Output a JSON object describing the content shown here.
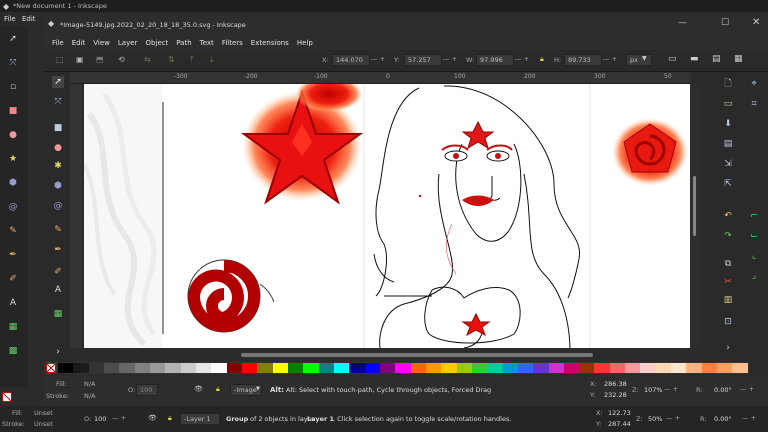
{
  "outer_window": {
    "title": "*New document 1 - Inkscape",
    "menu": [
      "File",
      "Edit"
    ]
  },
  "inner_window": {
    "title": "*Image-5149.jpg.2022_02_20_18_18_35.0.svg - Inkscape",
    "menu": [
      "File",
      "Edit",
      "View",
      "Layer",
      "Object",
      "Path",
      "Text",
      "Filters",
      "Extensions",
      "Help"
    ]
  },
  "tool_controls": {
    "x_label": "X:",
    "x_value": "144.070",
    "y_label": "Y:",
    "y_value": "57.257",
    "w_label": "W:",
    "w_value": "97.996",
    "h_label": "H:",
    "h_value": "89.733",
    "unit": "px"
  },
  "ruler_ticks": [
    "-300",
    "-200",
    "-100",
    "0",
    "100",
    "200",
    "300",
    "400",
    "500"
  ],
  "ruler_last": "50",
  "palette_colors": [
    "#000000",
    "#1a1a1a",
    "#333333",
    "#4d4d4d",
    "#666666",
    "#808080",
    "#999999",
    "#b3b3b3",
    "#cccccc",
    "#e6e6e6",
    "#ffffff",
    "#800000",
    "#ff0000",
    "#808000",
    "#ffff00",
    "#008000",
    "#00ff00",
    "#008080",
    "#00ffff",
    "#000080",
    "#0000ff",
    "#800080",
    "#ff00ff",
    "#ff6600",
    "#ff9900",
    "#ffcc00",
    "#99cc00",
    "#33cc33",
    "#00cc99",
    "#0099cc",
    "#3366ff",
    "#6633cc",
    "#cc33cc",
    "#cc0066",
    "#993300",
    "#ff3333",
    "#ff6666",
    "#ff9999",
    "#ffcccc",
    "#ffd9b3",
    "#ffe6cc",
    "#ffb380",
    "#ff8040",
    "#ffa060",
    "#ffc090"
  ],
  "status": {
    "fill_label": "Fill:",
    "fill_value": "N/A",
    "stroke_label": "Stroke:",
    "stroke_value": "N/A",
    "opacity_label": "O:",
    "opacity_value": "100",
    "layer_name": "-Image",
    "message": "Alt: Select with touch-path, Cycle through objects, Forced Drag",
    "cursor_x_label": "X:",
    "cursor_x": "286.38",
    "cursor_y_label": "Y:",
    "cursor_y": "232.28",
    "zoom_label": "Z:",
    "zoom": "107%",
    "rotate_label": "R:",
    "rotate": "0.00°"
  },
  "outer_status": {
    "fill_label": "Fill:",
    "fill_value": "Unset",
    "stroke_label": "Stroke:",
    "stroke_value": "Unset",
    "opacity_label": "O:",
    "opacity_value": "100",
    "layer_name": "-Layer 1",
    "message_bold": "Group",
    "message": " of 2 objects in layer ",
    "message_layer": "Layer 1",
    "message_tail": ". Click selection again to toggle scale/rotation handles.",
    "cursor_x_label": "X:",
    "cursor_x": "122.73",
    "cursor_y_label": "Y:",
    "cursor_y": "287.44",
    "zoom_label": "Z:",
    "zoom": "50%",
    "rotate_label": "R:",
    "rotate": "0.00°"
  },
  "colors": {
    "accent_red": "#e01010",
    "canvas": "#ffffff",
    "chrome": "#2d2d2d"
  }
}
